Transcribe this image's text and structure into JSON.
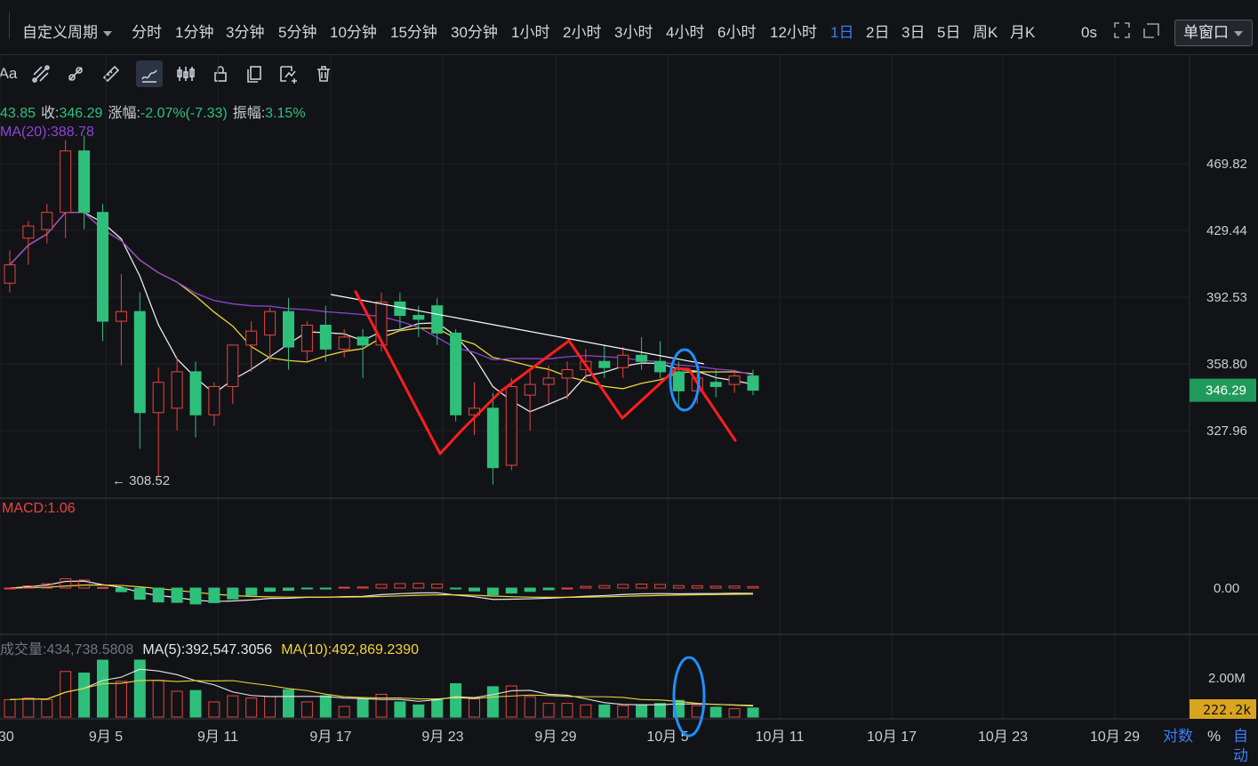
{
  "toolbar": {
    "custom_period": "自定义周期",
    "periods": [
      "分时",
      "1分钟",
      "3分钟",
      "5分钟",
      "10分钟",
      "15分钟",
      "30分钟",
      "1小时",
      "2小时",
      "3小时",
      "4小时",
      "6小时",
      "12小时",
      "1日",
      "2日",
      "3日",
      "5日",
      "周K",
      "月K"
    ],
    "active_period": "1日",
    "countdown": "0s",
    "window_mode": "单窗口"
  },
  "drawing_tools": [
    "text-tool-icon",
    "parallel-channel-icon",
    "ray-line-icon",
    "ruler-icon",
    "brush-icon",
    "candlestick-icon",
    "lock-icon",
    "layers-icon",
    "magnet-icon",
    "trash-icon"
  ],
  "ohlc_info": {
    "open_partial": "43.85",
    "close_label": "收:",
    "close": "346.29",
    "change_label": "涨幅:",
    "change": "-2.07%(-7.33)",
    "amplitude_label": "振幅:",
    "amplitude": "3.15%"
  },
  "ma_info": "MA(20):388.78",
  "macd_info": "MACD:1.06",
  "volume_info": {
    "label": "成交量:",
    "value": "434,738.5808",
    "ma5": "MA(5):392,547.3056",
    "ma10": "MA(10):492,869.2390"
  },
  "bottom_controls": {
    "log": "对数",
    "percent": "%",
    "auto": "自动"
  },
  "colors": {
    "up": "#e8463f",
    "down": "#2ec07b",
    "ma_white": "#e8e8e8",
    "ma_yellow": "#f0d43a",
    "ma_purple": "#8e44d6",
    "annotation_red": "#ff1e1e",
    "annotation_blue": "#1e90ff"
  },
  "chart_data": {
    "type": "candlestick",
    "price_axis_ticks": [
      469.82,
      429.44,
      392.53,
      358.8,
      327.96
    ],
    "last_price_label": "346.29",
    "low_marker": "← 308.52",
    "x_tick_labels": [
      "30",
      "9月 5",
      "9月 11",
      "9月 17",
      "9月 23",
      "9月 29",
      "10月 5",
      "10月 11",
      "10月 17",
      "10月 23",
      "10月 29"
    ],
    "candles": [
      {
        "o": 400,
        "h": 418,
        "l": 395,
        "c": 410
      },
      {
        "o": 425,
        "h": 435,
        "l": 410,
        "c": 432
      },
      {
        "o": 430,
        "h": 445,
        "l": 422,
        "c": 440
      },
      {
        "o": 440,
        "h": 485,
        "l": 425,
        "c": 478
      },
      {
        "o": 478,
        "h": 488,
        "l": 430,
        "c": 440
      },
      {
        "o": 440,
        "h": 445,
        "l": 370,
        "c": 380
      },
      {
        "o": 380,
        "h": 405,
        "l": 358,
        "c": 385
      },
      {
        "o": 385,
        "h": 395,
        "l": 320,
        "c": 336
      },
      {
        "o": 336,
        "h": 357,
        "l": 308.52,
        "c": 350
      },
      {
        "o": 338,
        "h": 362,
        "l": 328,
        "c": 355
      },
      {
        "o": 355,
        "h": 360,
        "l": 325,
        "c": 335
      },
      {
        "o": 335,
        "h": 350,
        "l": 330,
        "c": 348
      },
      {
        "o": 348,
        "h": 368,
        "l": 340,
        "c": 368
      },
      {
        "o": 368,
        "h": 380,
        "l": 355,
        "c": 375
      },
      {
        "o": 373,
        "h": 387,
        "l": 360,
        "c": 385
      },
      {
        "o": 385,
        "h": 392,
        "l": 356,
        "c": 367
      },
      {
        "o": 365,
        "h": 380,
        "l": 360,
        "c": 378
      },
      {
        "o": 378,
        "h": 388,
        "l": 360,
        "c": 366
      },
      {
        "o": 366,
        "h": 376,
        "l": 362,
        "c": 372
      },
      {
        "o": 372,
        "h": 376,
        "l": 352,
        "c": 368
      },
      {
        "o": 368,
        "h": 395,
        "l": 365,
        "c": 390
      },
      {
        "o": 390,
        "h": 395,
        "l": 375,
        "c": 383
      },
      {
        "o": 383,
        "h": 388,
        "l": 372,
        "c": 381
      },
      {
        "o": 388,
        "h": 392,
        "l": 368,
        "c": 374
      },
      {
        "o": 374,
        "h": 376,
        "l": 332,
        "c": 335
      },
      {
        "o": 335,
        "h": 350,
        "l": 326,
        "c": 338
      },
      {
        "o": 338,
        "h": 345,
        "l": 305,
        "c": 312
      },
      {
        "o": 313,
        "h": 352,
        "l": 311,
        "c": 348
      },
      {
        "o": 344,
        "h": 355,
        "l": 328,
        "c": 349
      },
      {
        "o": 349,
        "h": 358,
        "l": 340,
        "c": 352
      },
      {
        "o": 352,
        "h": 360,
        "l": 342,
        "c": 356
      },
      {
        "o": 356,
        "h": 366,
        "l": 350,
        "c": 360
      },
      {
        "o": 360,
        "h": 368,
        "l": 352,
        "c": 357
      },
      {
        "o": 357,
        "h": 367,
        "l": 352,
        "c": 363
      },
      {
        "o": 363,
        "h": 372,
        "l": 356,
        "c": 360
      },
      {
        "o": 360,
        "h": 370,
        "l": 352,
        "c": 355
      },
      {
        "o": 355,
        "h": 360,
        "l": 338,
        "c": 346
      },
      {
        "o": 346,
        "h": 355,
        "l": 340,
        "c": 352
      },
      {
        "o": 350,
        "h": 356,
        "l": 343,
        "c": 348
      },
      {
        "o": 349,
        "h": 356,
        "l": 345,
        "c": 353
      },
      {
        "o": 353,
        "h": 356,
        "l": 344,
        "c": 346.29
      }
    ],
    "macd_zero_label": "0.00",
    "volume_axis_label": "2.00M",
    "volume_last_label": "222.2k"
  }
}
